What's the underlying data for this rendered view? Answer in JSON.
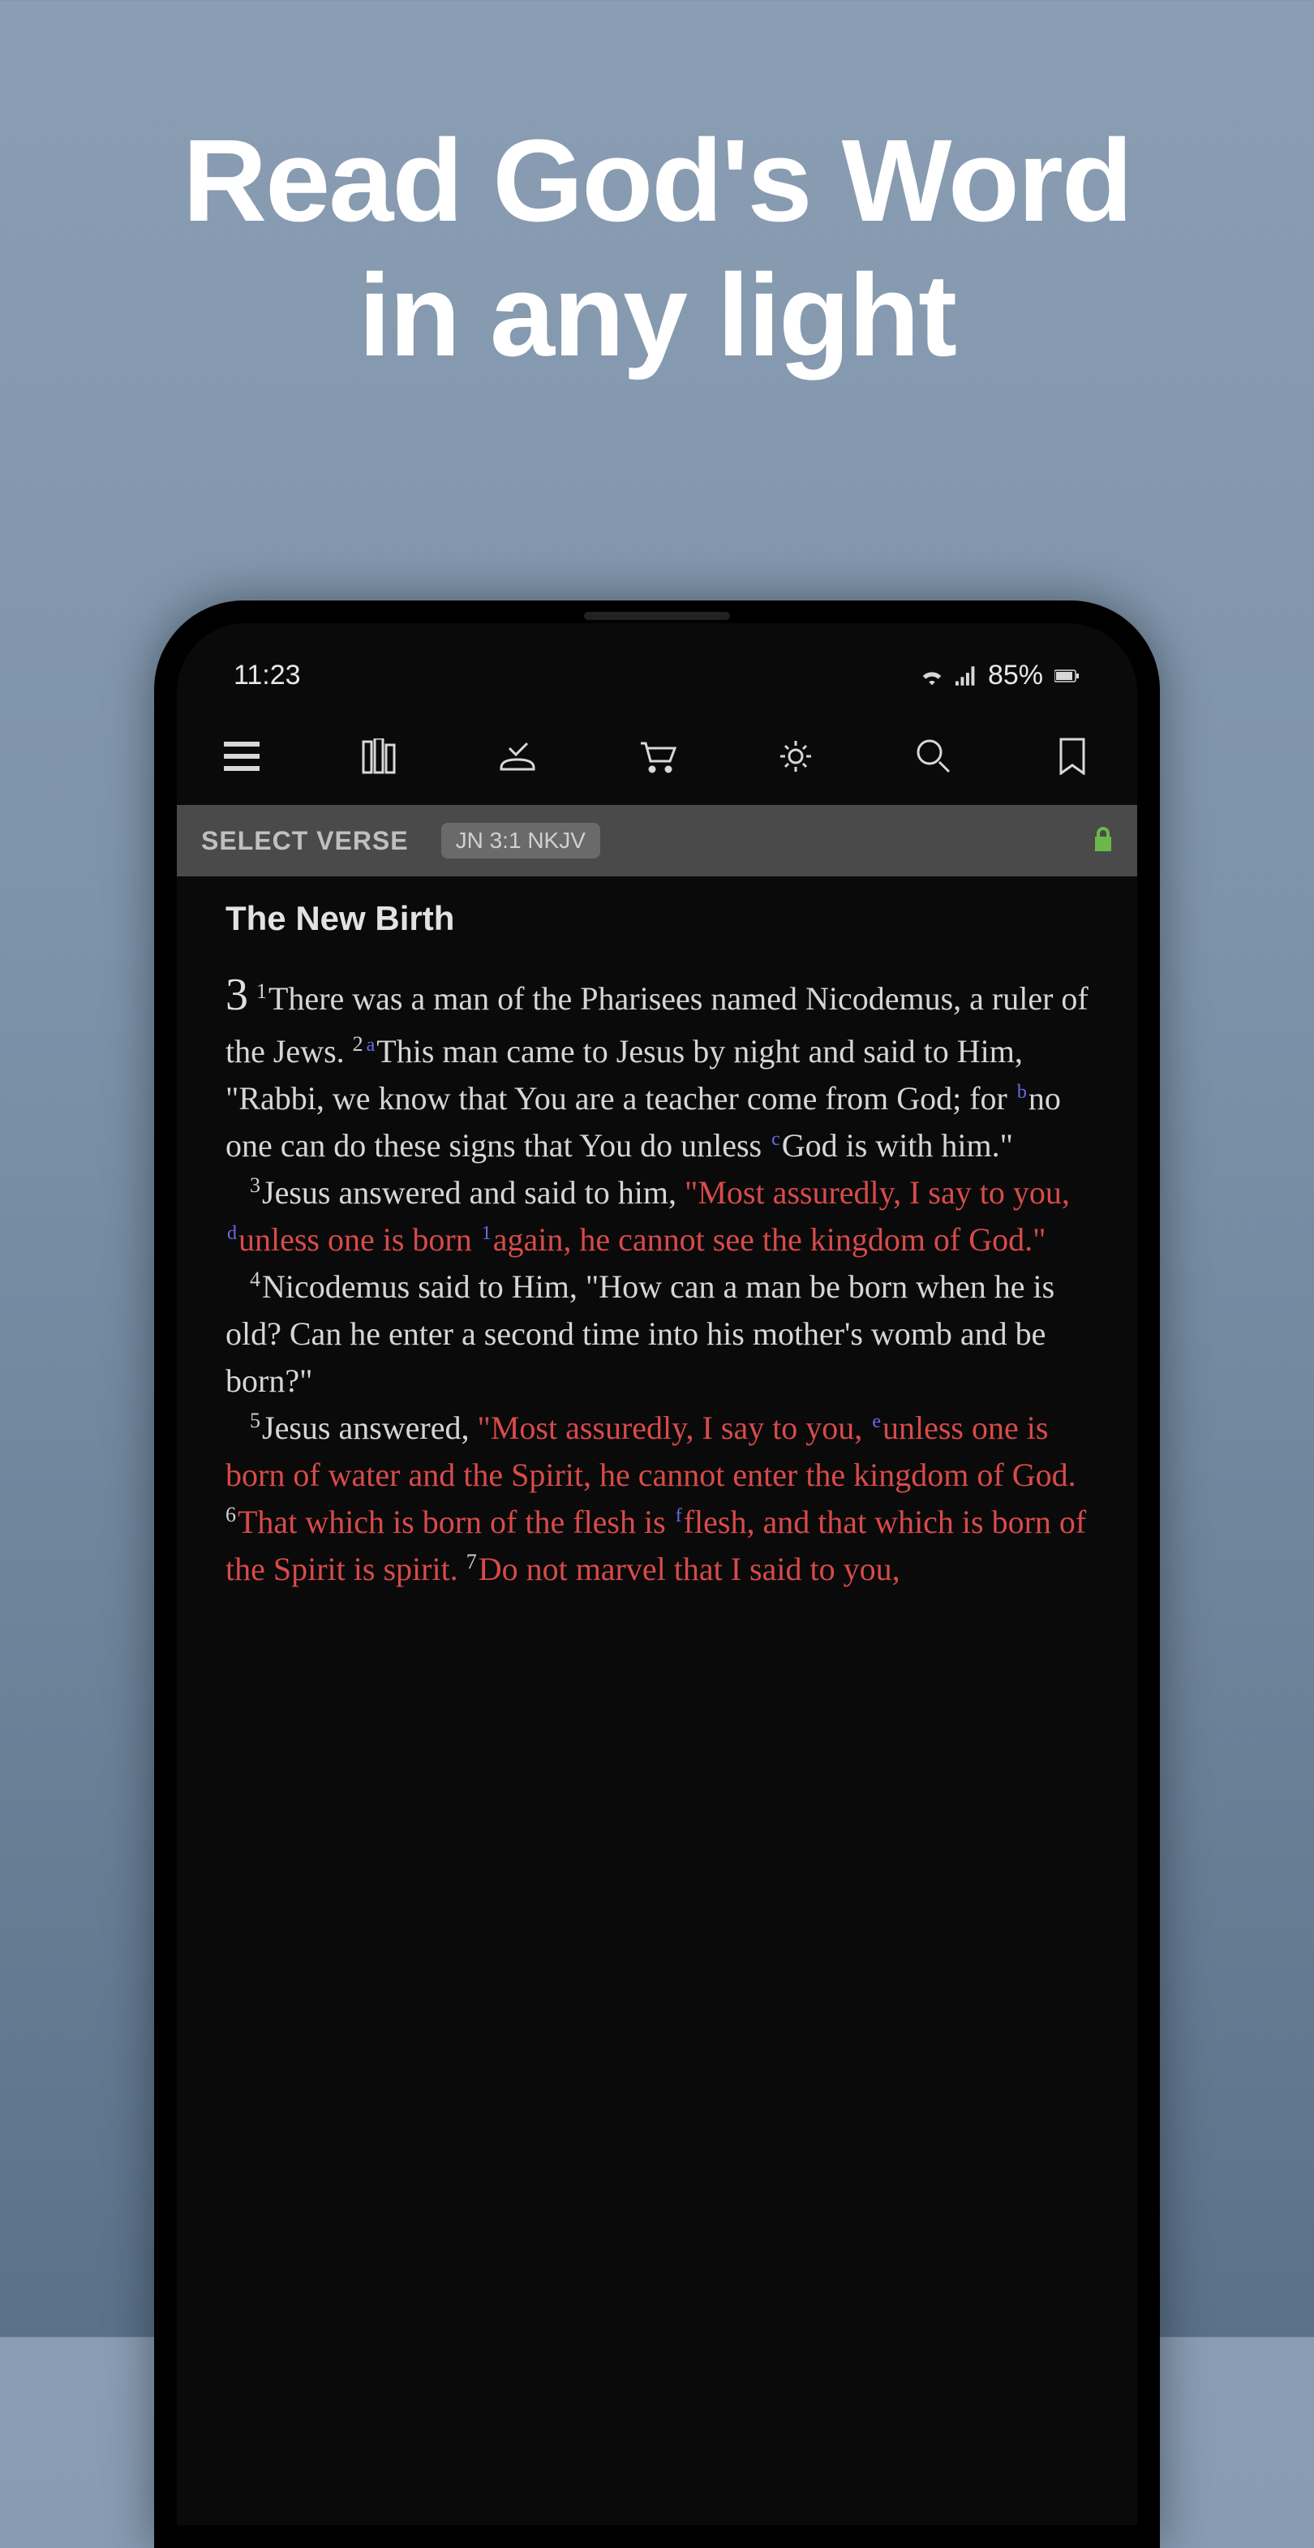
{
  "headline": {
    "line1": "Read God's Word",
    "line2": "in any light"
  },
  "statusBar": {
    "time": "11:23",
    "battery": "85%"
  },
  "toolbar": {
    "items": [
      {
        "name": "menu-icon"
      },
      {
        "name": "library-icon"
      },
      {
        "name": "notes-icon"
      },
      {
        "name": "cart-icon"
      },
      {
        "name": "settings-icon"
      },
      {
        "name": "search-icon"
      },
      {
        "name": "bookmark-icon"
      }
    ]
  },
  "verseBar": {
    "label": "SELECT VERSE",
    "reference": "JN 3:1 NKJV"
  },
  "passage": {
    "sectionTitle": "The New Birth",
    "chapter": "3",
    "verses": [
      {
        "n": "1",
        "refs": [],
        "text": "There was a man of the Pharisees named Nicodemus, a ruler of the Jews. ",
        "red": false
      },
      {
        "n": "2",
        "refs": [
          "a"
        ],
        "text": "This man came to Jesus by night and said to Him, \"Rabbi, we know that You are a teacher come from God; for ",
        "red": false
      },
      {
        "refs": [
          "b"
        ],
        "text": "no one can do these signs that You do unless ",
        "red": false
      },
      {
        "refs": [
          "c"
        ],
        "text": "God is with him.\"",
        "red": false
      },
      {
        "break": true
      },
      {
        "n": "3",
        "text": "Jesus answered and said to him, ",
        "red": false,
        "indent": true
      },
      {
        "text": "\"Most assuredly, I say to you, ",
        "red": true
      },
      {
        "refs": [
          "d"
        ],
        "text": "unless one is born ",
        "red": true
      },
      {
        "refs": [
          "1"
        ],
        "text": "again, he cannot see the kingdom of God.\"",
        "red": true
      },
      {
        "break": true
      },
      {
        "n": "4",
        "text": "Nicodemus said to Him, \"How can a man be born when he is old? Can he enter a second time into his mother's womb and be born?\"",
        "red": false,
        "indent": true
      },
      {
        "break": true
      },
      {
        "n": "5",
        "text": "Jesus answered, ",
        "red": false,
        "indent": true
      },
      {
        "text": "\"Most assuredly, I say to you, ",
        "red": true
      },
      {
        "refs": [
          "e"
        ],
        "text": "unless one is born of water and the Spirit, he cannot enter the kingdom of God. ",
        "red": true
      },
      {
        "n": "6",
        "text": "That which is born of the flesh is ",
        "red": true
      },
      {
        "refs": [
          "f"
        ],
        "text": "flesh, and that which is born of the Spirit is spirit. ",
        "red": true
      },
      {
        "n": "7",
        "text": "Do not marvel that I said to you,",
        "red": true
      }
    ]
  }
}
